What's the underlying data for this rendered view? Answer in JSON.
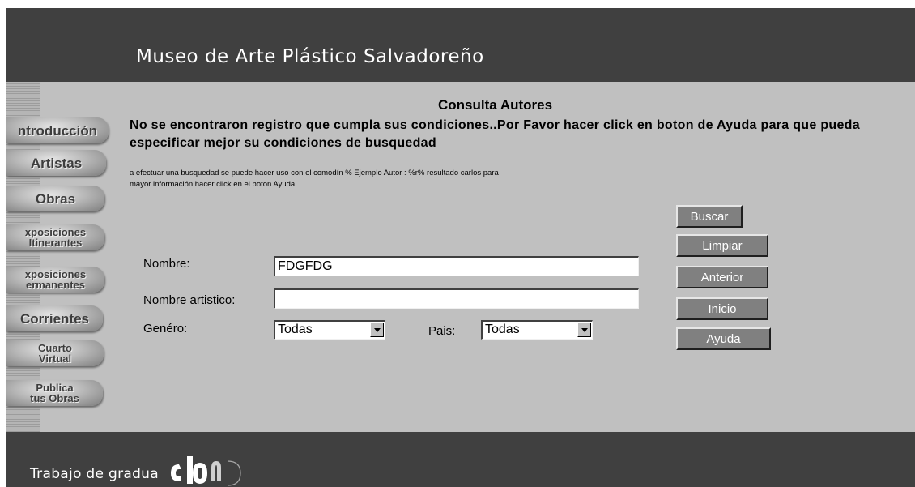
{
  "header": {
    "title": "Museo de Arte Plástico Salvadoreño"
  },
  "nav": {
    "items": [
      {
        "line1": "ntroducción",
        "line2": ""
      },
      {
        "line1": "Artistas",
        "line2": ""
      },
      {
        "line1": "Obras",
        "line2": ""
      },
      {
        "line1": "xposiciones",
        "line2": "Itinerantes"
      },
      {
        "line1": "xposiciones",
        "line2": "ermanentes"
      },
      {
        "line1": "Corrientes",
        "line2": ""
      },
      {
        "line1": "Cuarto",
        "line2": "Virtual"
      },
      {
        "line1": "Publica",
        "line2": "tus Obras"
      }
    ]
  },
  "form": {
    "title": "Consulta Autores",
    "warning": "No se encontraron registro que cumpla sus condiciones..Por Favor hacer click en boton de Ayuda para que pueda especificar mejor su condiciones de busquedad",
    "hint_line1": "a efectuar una busquedad se puede hacer uso con el comodín % Ejemplo Autor : %r% resultado carlos para",
    "hint_line2": "mayor información hacer click en el boton Ayuda",
    "nombre_label": "Nombre:",
    "nombre_value": "FDGFDG",
    "artistico_label": "Nombre artistico:",
    "artistico_value": "",
    "genero_label": "Genéro:",
    "genero_value": "Todas",
    "pais_label": "Pais:",
    "pais_value": "Todas"
  },
  "buttons": {
    "buscar": "Buscar",
    "limpiar": "Limpiar",
    "anterior": "Anterior",
    "inicio": "Inicio",
    "ayuda": "Ayuda"
  },
  "footer": {
    "text": "Trabajo de gradua"
  }
}
